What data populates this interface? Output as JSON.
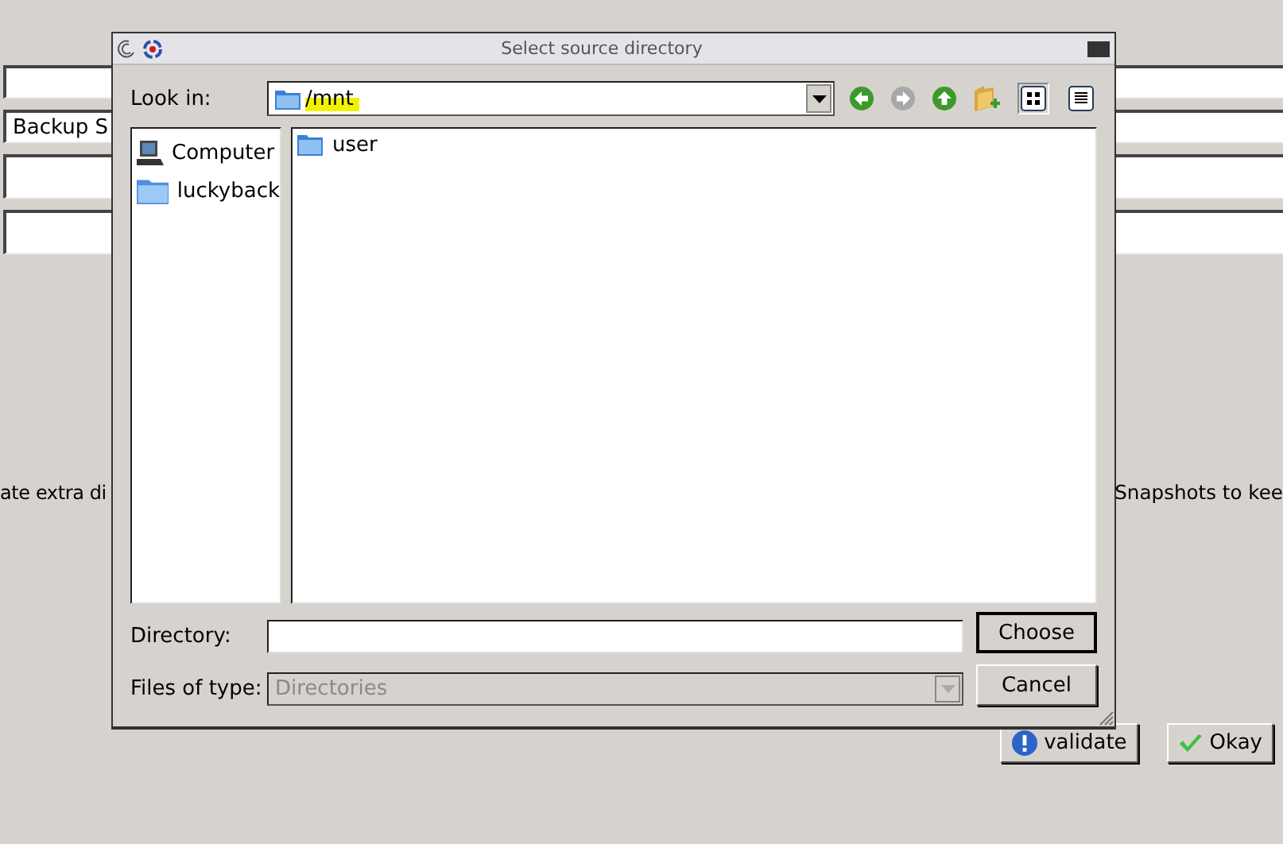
{
  "background": {
    "fields": [
      {
        "kind": "short"
      },
      {
        "kind": "short",
        "value": "Backup S"
      },
      {
        "kind": "tall"
      },
      {
        "kind": "tall"
      }
    ],
    "left_label": "ate extra di",
    "right_label": "Snapshots to kee",
    "buttons": [
      {
        "label": "validate",
        "kind": "info"
      },
      {
        "label": "Okay",
        "kind": "check"
      }
    ]
  },
  "dialog": {
    "title": "Select source directory",
    "look_in": {
      "label": "Look in:",
      "value": "/mnt",
      "highlighted": true
    },
    "toolbar": [
      {
        "kind": "back",
        "disabled": false
      },
      {
        "kind": "forward",
        "disabled": true
      },
      {
        "kind": "up",
        "disabled": false
      },
      {
        "kind": "new-folder"
      },
      {
        "kind": "icon-view",
        "selected": true
      },
      {
        "kind": "list-view",
        "selected": false
      }
    ],
    "sidebar": [
      {
        "label": "Computer",
        "kind": "computer"
      },
      {
        "label": "luckyback",
        "kind": "folder"
      }
    ],
    "files": [
      {
        "name": "user"
      }
    ],
    "directory": {
      "label": "Directory:"
    },
    "file_type": {
      "label": "Files of type:",
      "value": "Directories",
      "disabled": true
    },
    "buttons": [
      {
        "label": "Choose",
        "default": true
      },
      {
        "label": "Cancel",
        "default": false
      }
    ]
  }
}
